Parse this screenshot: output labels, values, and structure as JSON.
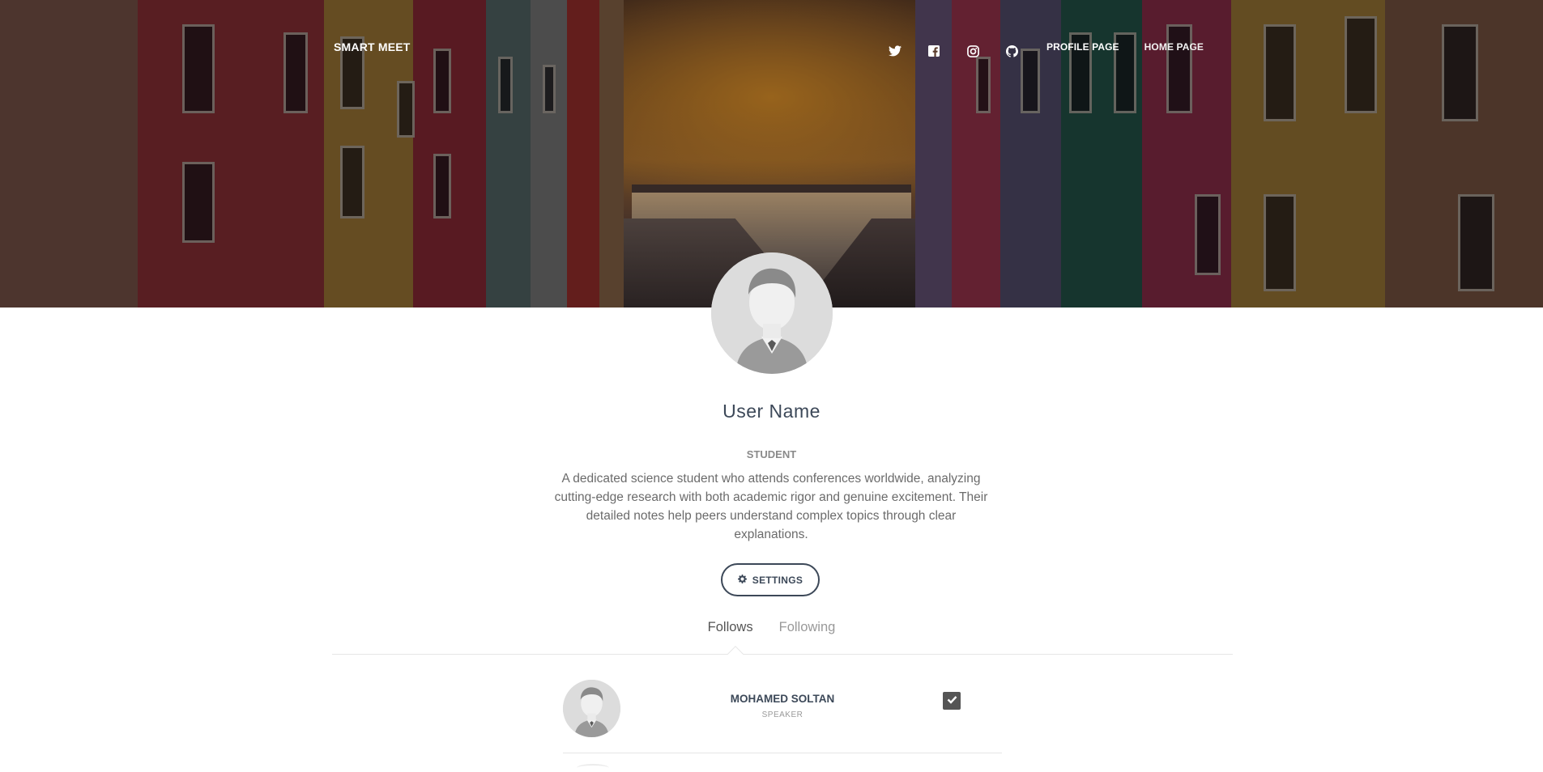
{
  "navbar": {
    "brand": "SMART MEET",
    "icons": [
      "twitter-icon",
      "facebook-icon",
      "instagram-icon",
      "github-icon"
    ],
    "links": [
      "PROFILE PAGE",
      "HOME PAGE"
    ]
  },
  "profile": {
    "name": "User Name",
    "role": "STUDENT",
    "bio": "A dedicated science student who attends conferences worldwide, analyzing cutting-edge research with both academic rigor and genuine excitement. Their detailed notes help peers understand complex topics through clear explanations.",
    "settings_label": "SETTINGS"
  },
  "tabs": [
    "Follows",
    "Following"
  ],
  "active_tab": "Follows",
  "follows": [
    {
      "name": "MOHAMED SOLTAN",
      "role": "SPEAKER",
      "checked": true
    }
  ],
  "colors": {
    "text_dark": "#3c4858",
    "text_muted": "#999999",
    "checkbox": "#555555"
  }
}
